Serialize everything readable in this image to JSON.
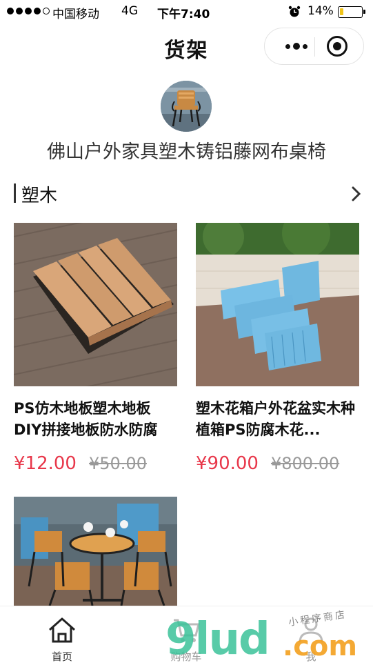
{
  "status_bar": {
    "carrier": "中国移动",
    "network": "4G",
    "time": "下午7:40",
    "battery": "14%"
  },
  "nav": {
    "title": "货架",
    "more_icon": "more-dots-icon",
    "close_icon": "target-circle-icon"
  },
  "shop": {
    "name": "佛山户外家具塑木铸铝藤网布桌椅"
  },
  "section": {
    "title": "塑木",
    "arrow_icon": "chevron-right-icon"
  },
  "products": [
    {
      "name": "PS仿木地板塑木地板DIY拼接地板防水防腐",
      "price": "¥12.00",
      "original_price": "¥50.00"
    },
    {
      "name": "塑木花箱户外花盆实木种植箱PS防腐木花...",
      "price": "¥90.00",
      "original_price": "¥800.00"
    },
    {
      "name": "",
      "price": "",
      "original_price": ""
    }
  ],
  "tabs": [
    {
      "label": "首页",
      "icon": "home-icon"
    },
    {
      "label": "购物车",
      "icon": "cart-icon"
    },
    {
      "label": "我",
      "icon": "user-icon"
    }
  ],
  "watermark": {
    "main": "9lud",
    "com": ".com",
    "small": "小程序商店"
  },
  "colors": {
    "price": "#e8374a",
    "original_price": "#999999",
    "watermark_green": "#3cc39a",
    "watermark_orange": "#f3a01f"
  }
}
